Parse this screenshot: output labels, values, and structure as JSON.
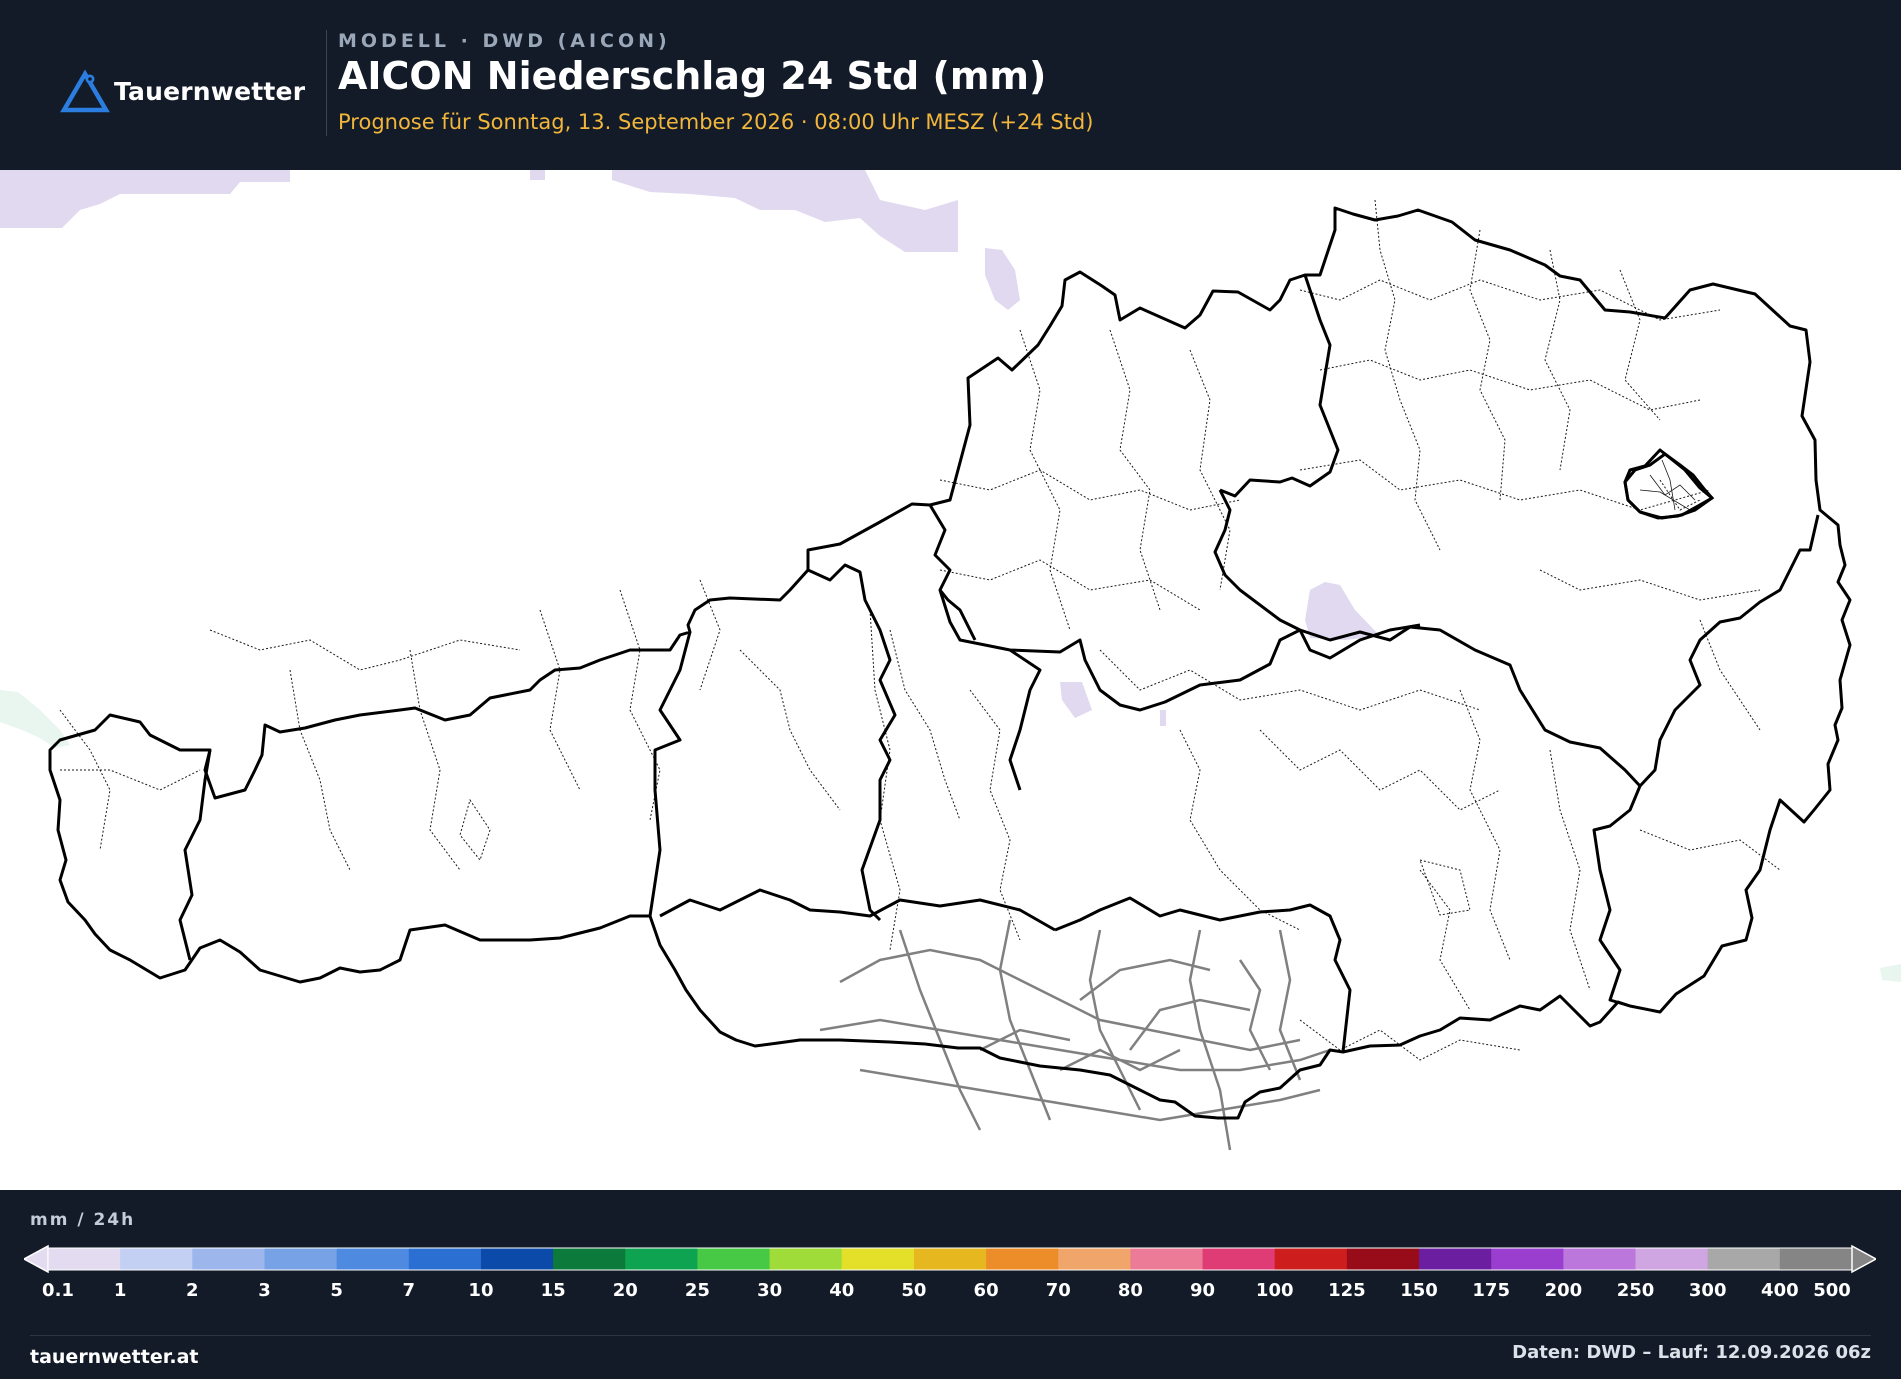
{
  "header": {
    "logo_text": "Tauernwetter",
    "kicker": "MODELL · DWD (AICON)",
    "title": "AICON Niederschlag 24 Std (mm)",
    "subtitle": "Prognose für Sonntag, 13. September 2026 · 08:00 Uhr MESZ  (+24 Std)"
  },
  "map": {
    "region": "Austria",
    "precip_color": "#e0d9ef"
  },
  "legend": {
    "unit": "mm / 24h",
    "ticks": [
      "0.1",
      "1",
      "2",
      "3",
      "5",
      "7",
      "10",
      "15",
      "20",
      "25",
      "30",
      "40",
      "50",
      "60",
      "70",
      "80",
      "90",
      "100",
      "125",
      "150",
      "175",
      "200",
      "250",
      "300",
      "400",
      "500"
    ],
    "colors": [
      "#e3dcf0",
      "#c3cff3",
      "#9db7ec",
      "#78a2e6",
      "#4d8ae0",
      "#2a6fd1",
      "#0b4aa8",
      "#0b7a3a",
      "#0ea350",
      "#48c945",
      "#9fdc3a",
      "#e4e02a",
      "#e7b71f",
      "#ec8d29",
      "#f0a56a",
      "#ec7b97",
      "#df3b75",
      "#cd1d1d",
      "#970c18",
      "#6b1fa0",
      "#9a3ed0",
      "#bb77dc",
      "#d0a6e2",
      "#a8a8a8",
      "#858585"
    ]
  },
  "footer": {
    "site": "tauernwetter.at",
    "credits": "Daten: DWD – Lauf: 12.09.2026 06z"
  }
}
